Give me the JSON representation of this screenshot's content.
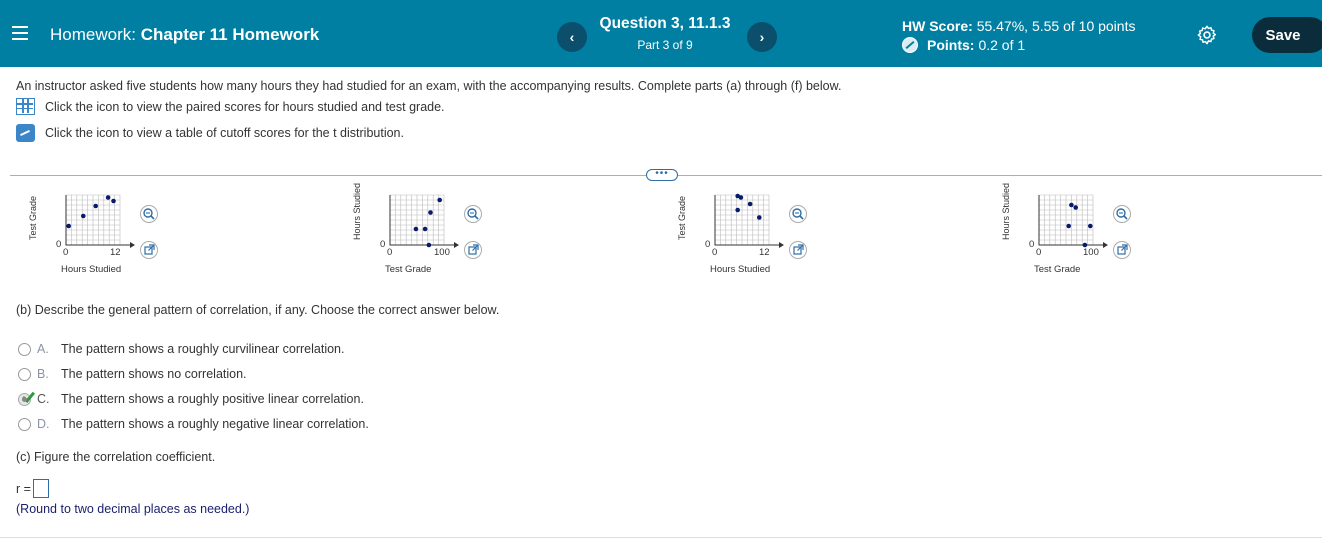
{
  "header": {
    "hw_prefix": "Homework:",
    "hw_name": "Chapter 11 Homework",
    "question_title": "Question 3, 11.1.3",
    "question_part": "Part 3 of 9",
    "prev_label": "‹",
    "next_label": "›",
    "hw_score_label": "HW Score:",
    "hw_score_value": "55.47%, 5.55 of 10 points",
    "points_label": "Points:",
    "points_value": "0.2 of 1",
    "save_label": "Save"
  },
  "problem": {
    "intro": "An instructor asked five students how many hours they had studied for an exam, with the accompanying results. Complete parts (a) through (f) below.",
    "link_scores": "Click the icon to view the paired scores for hours studied and test grade.",
    "link_table": "Click the icon to view a table of cutoff scores for the t distribution.",
    "more_label": "•••"
  },
  "graph_choices": [
    {
      "ylabel": "Test Grade",
      "xlabel": "Hours Studied",
      "x_min_tick": "0",
      "x_max_tick": "12",
      "y_min_tick": "0",
      "points": [
        [
          0.05,
          0.62
        ],
        [
          0.32,
          0.42
        ],
        [
          0.55,
          0.22
        ],
        [
          0.78,
          0.05
        ],
        [
          0.88,
          0.12
        ]
      ]
    },
    {
      "ylabel": "Hours Studied",
      "xlabel": "Test Grade",
      "x_min_tick": "0",
      "x_max_tick": "100",
      "y_min_tick": "0",
      "points": [
        [
          0.48,
          0.68
        ],
        [
          0.65,
          0.68
        ],
        [
          0.75,
          0.35
        ],
        [
          0.92,
          0.1
        ],
        [
          0.72,
          1.0
        ]
      ]
    },
    {
      "ylabel": "Test Grade",
      "xlabel": "Hours Studied",
      "x_min_tick": "0",
      "x_max_tick": "12",
      "y_min_tick": "0",
      "points": [
        [
          0.42,
          0.02
        ],
        [
          0.42,
          0.3
        ],
        [
          0.82,
          0.45
        ],
        [
          0.65,
          0.18
        ],
        [
          0.48,
          0.05
        ]
      ]
    },
    {
      "ylabel": "Hours Studied",
      "xlabel": "Test Grade",
      "x_min_tick": "0",
      "x_max_tick": "100",
      "y_min_tick": "0",
      "points": [
        [
          0.6,
          0.2
        ],
        [
          0.68,
          0.25
        ],
        [
          0.55,
          0.62
        ],
        [
          0.95,
          0.62
        ],
        [
          0.85,
          1.0
        ]
      ]
    }
  ],
  "part_b": {
    "prompt": "(b) Describe the general pattern of correlation, if any. Choose the correct answer below.",
    "choices": [
      {
        "letter": "A.",
        "text": "The pattern shows a roughly curvilinear correlation.",
        "selected": false
      },
      {
        "letter": "B.",
        "text": "The pattern shows no correlation.",
        "selected": false
      },
      {
        "letter": "C.",
        "text": "The pattern shows a roughly positive linear correlation.",
        "selected": true
      },
      {
        "letter": "D.",
        "text": "The pattern shows a roughly negative linear correlation.",
        "selected": false
      }
    ]
  },
  "part_c": {
    "prompt": "(c) Figure the correlation coefficient.",
    "r_label": "r =",
    "r_value": "",
    "round_note": "(Round to two decimal places as needed.)"
  },
  "colors": {
    "header_bg": "#007fa3",
    "save_bg": "#0b2c3a",
    "link_blue": "#3a86c8",
    "check_green": "#2e9b3a",
    "point_navy": "#0a1a6a"
  }
}
